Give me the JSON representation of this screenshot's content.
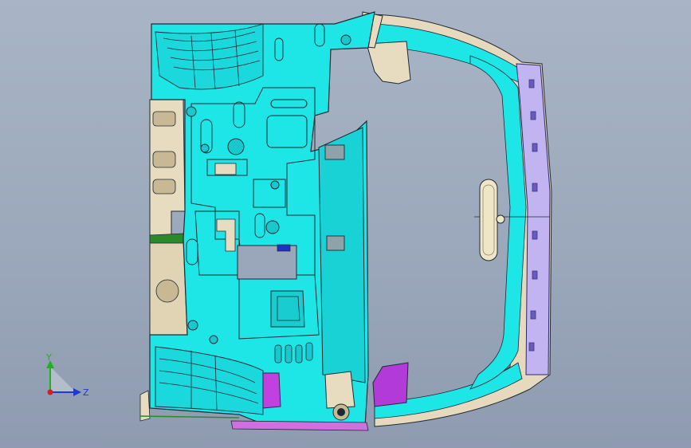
{
  "viewport": {
    "background_top": "#a9b5c6",
    "background_bottom": "#8e9bb0"
  },
  "colors": {
    "panel": "#1ee6e6",
    "panel_dark": "#14c4c8",
    "edge": "#1f2a33",
    "beige": "#e8dcc0",
    "beige_dark": "#c8b894",
    "violet": "#c2b4f0",
    "magenta": "#c040e0",
    "blue_clip": "#2030c0",
    "green_edge": "#2a8a2a"
  },
  "triad": {
    "y_label": "Y",
    "z_label": "Z",
    "y_color": "#20b020",
    "z_color": "#1f3ad0",
    "origin_color": "#d02020"
  }
}
